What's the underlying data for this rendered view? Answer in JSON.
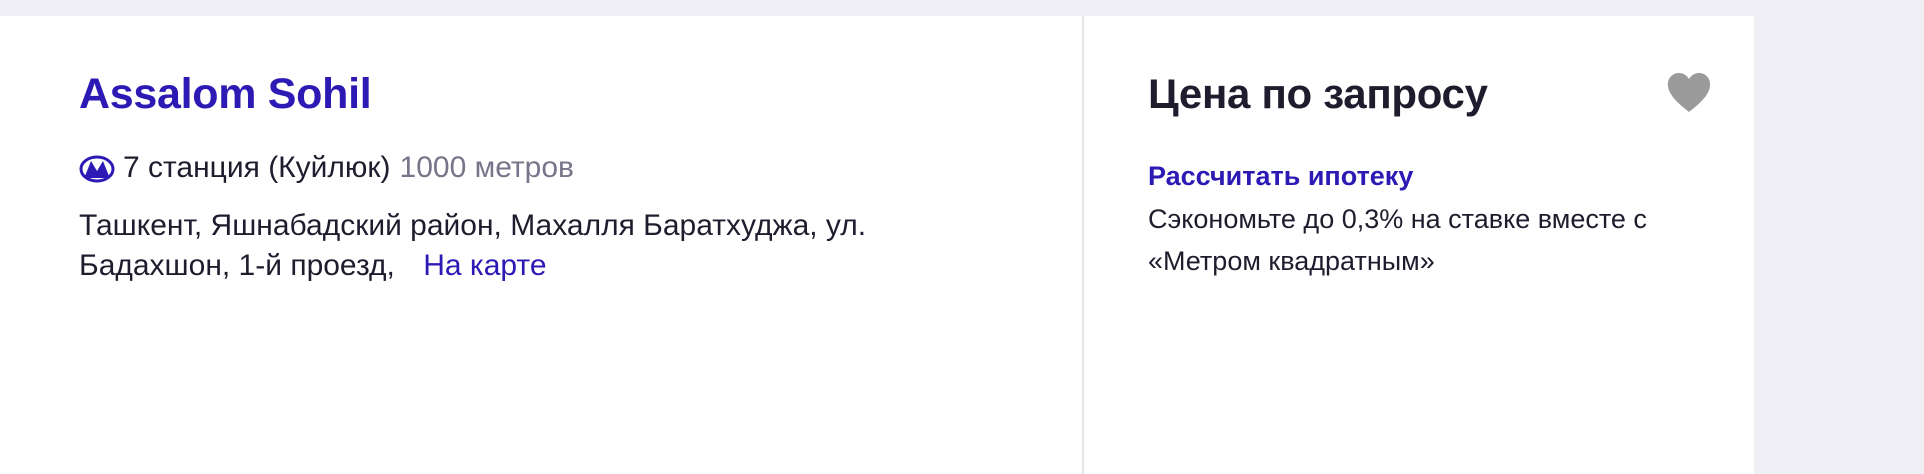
{
  "listing": {
    "title": "Assalom Sohil",
    "metro": {
      "icon": "metro-icon",
      "station": "7 станция (Куйлюк)",
      "distance": "1000 метров"
    },
    "address": "Ташкент, Яшнабадский район, Махалля Баратхуджа, ул. Бадахшон, 1-й проезд,",
    "map_link": "На карте"
  },
  "pricing": {
    "price": "Цена по запросу",
    "favorite_icon": "heart-icon",
    "mortgage_link": "Рассчитать ипотеку",
    "promo": "Сэкономьте до 0,3% на ставке вместе с «Метром квадратным»"
  },
  "colors": {
    "accent": "#2d1ab5",
    "text": "#1f1c2e",
    "muted": "#77758a",
    "heart": "#9a9a9a",
    "background": "#f0eff5"
  }
}
